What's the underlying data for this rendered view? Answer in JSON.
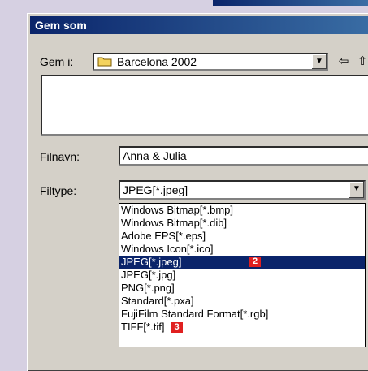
{
  "dialog": {
    "title": "Gem som",
    "save_in_label": "Gem i:",
    "save_in_value": "Barcelona 2002",
    "filename_label": "Filnavn:",
    "filename_value": "Anna & Julia",
    "filetype_label": "Filtype:",
    "filetype_value": "JPEG[*.jpeg]"
  },
  "filetype_options": [
    {
      "label": "Windows Bitmap[*.bmp]"
    },
    {
      "label": "Windows Bitmap[*.dib]"
    },
    {
      "label": "Adobe EPS[*.eps]"
    },
    {
      "label": "Windows Icon[*.ico]"
    },
    {
      "label": "JPEG[*.jpeg]",
      "selected": true,
      "badge": "2"
    },
    {
      "label": "JPEG[*.jpg]"
    },
    {
      "label": "PNG[*.png]"
    },
    {
      "label": "Standard[*.pxa]"
    },
    {
      "label": "FujiFilm Standard Format[*.rgb]"
    },
    {
      "label": "TIFF[*.tif]",
      "badge": "3"
    }
  ],
  "colors": {
    "titlebar": "#0a246a",
    "selection": "#0a246a",
    "badge": "#e02020",
    "background": "#d6d0e2"
  },
  "icons": {
    "folder": "folder-icon",
    "back": "back-arrow-icon",
    "up": "up-folder-icon",
    "dropdown": "chevron-down-icon"
  }
}
